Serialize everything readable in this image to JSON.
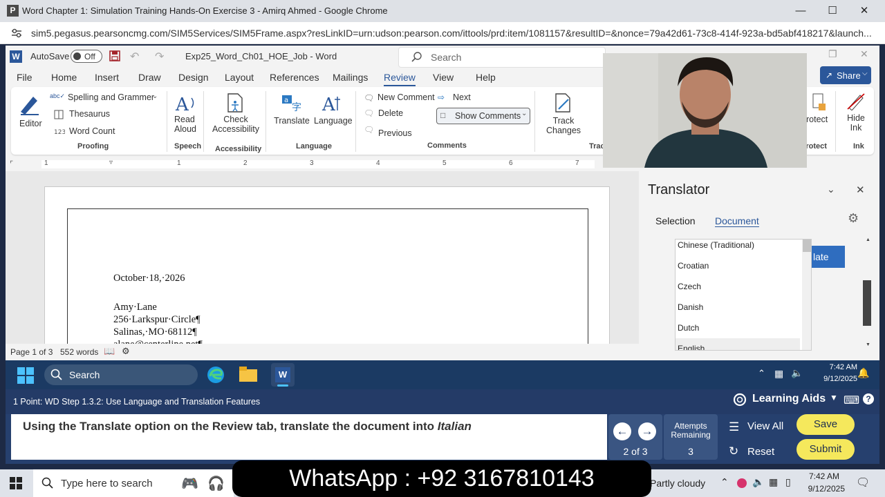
{
  "browser": {
    "title": "Word Chapter 1: Simulation Training Hands-On Exercise 3 - Amirq Ahmed - Google Chrome",
    "url": "sim5.pegasus.pearsoncmg.com/SIM5Services/SIM5Frame.aspx?resLinkID=urn:udson:pearson.com/ittools/prd:item/1081157&resultID=&nonce=79a42d61-73c8-414f-923a-bd5abf418217&launch..."
  },
  "word": {
    "autosave_label": "AutoSave",
    "autosave_state": "Off",
    "doc_title": "Exp25_Word_Ch01_HOE_Job - Word",
    "search_placeholder": "Search",
    "share_label": "Share",
    "menu_tabs": [
      "File",
      "Home",
      "Insert",
      "Draw",
      "Design",
      "Layout",
      "References",
      "Mailings",
      "Review",
      "View",
      "Help"
    ],
    "active_tab": "Review",
    "ribbon": {
      "editor": "Editor",
      "spelling": "Spelling and Grammer",
      "thesaurus": "Thesaurus",
      "word_count": "Word Count",
      "proofing": "Proofing",
      "read_aloud_1": "Read",
      "read_aloud_2": "Aloud",
      "speech": "Speech",
      "check_acc_1": "Check",
      "check_acc_2": "Accessibility",
      "accessibility": "Accessibility",
      "translate": "Translate",
      "language_btn": "Language",
      "language_group": "Language",
      "new_comment": "New Comment",
      "delete": "Delete",
      "previous": "Previous",
      "next": "Next",
      "show_comments": "Show Comments",
      "comments_group": "Comments",
      "track_1": "Track",
      "track_2": "Changes",
      "tracking_group": "Tracki",
      "protect": "rotect",
      "protect_group": "Protect",
      "hide_ink_1": "Hide",
      "hide_ink_2": "Ink",
      "ink_group": "Ink"
    },
    "ruler_numbers": [
      "1",
      "1",
      "2",
      "3",
      "4",
      "5",
      "6",
      "7"
    ],
    "document": {
      "date": "October·18,·2026",
      "name": "Amy·Lane",
      "street": "256·Larkspur·Circle¶",
      "city": "Salinas,·MO·68112¶",
      "email": "alane@centerline.net¶"
    },
    "status": {
      "page": "Page 1 of 3",
      "words": "552 words"
    }
  },
  "translator": {
    "title": "Translator",
    "tabs": [
      "Selection",
      "Document"
    ],
    "active_tab": "Document",
    "translate_btn_partial": "late",
    "languages": [
      "Chinese (Traditional)",
      "Croatian",
      "Czech",
      "Danish",
      "Dutch",
      "English"
    ]
  },
  "taskbar_inner": {
    "search": "Search",
    "time": "7:42 AM",
    "date": "9/12/2025"
  },
  "simulation": {
    "step": "1 Point: WD Step 1.3.2: Use Language and Translation Features",
    "learning_aids": "Learning Aids",
    "instruction_main": "Using the Translate option on the Review tab, translate the document into ",
    "instruction_lang": "Italian",
    "progress": "2 of 3",
    "attempts_label_1": "Attempts",
    "attempts_label_2": "Remaining",
    "attempts": "3",
    "view_all": "View All",
    "reset": "Reset",
    "save": "Save",
    "submit": "Submit"
  },
  "os_taskbar": {
    "search_placeholder": "Type here to search",
    "weather": "Partly cloudy",
    "time": "7:42 AM",
    "date": "9/12/2025"
  },
  "overlay": {
    "whatsapp": "WhatsApp : +92 3167810143"
  },
  "colors": {
    "word_blue": "#2b579a",
    "sim_navy": "#243b67",
    "button_yellow": "#f5e85c",
    "translate_blue": "#2f6dbf"
  }
}
